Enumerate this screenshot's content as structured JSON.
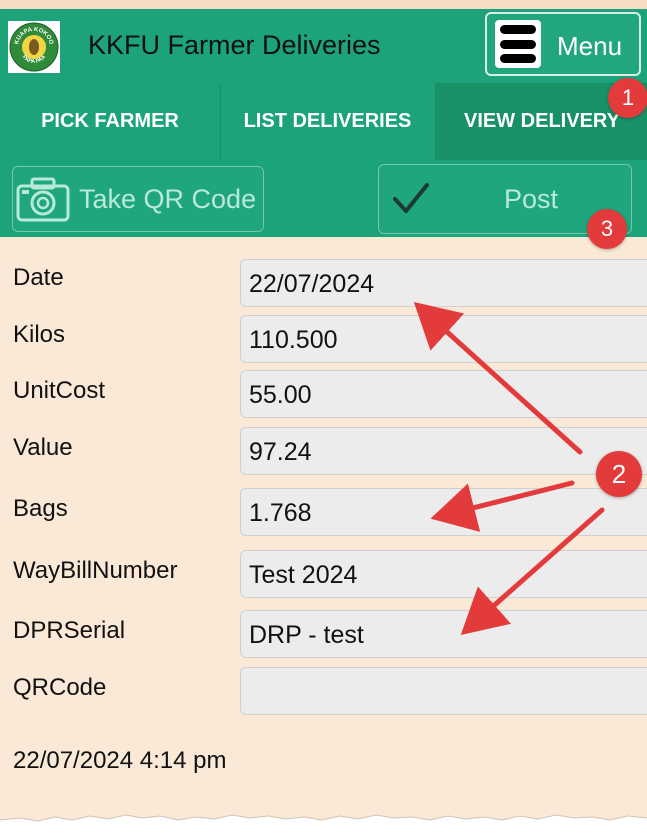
{
  "app": {
    "title": "KKFU Farmer Deliveries",
    "menu_label": "Menu",
    "logo_text_top": "KUAPA KOKOO",
    "logo_text_bottom": "PAPA PAA"
  },
  "tabs": [
    {
      "label": "PICK FARMER",
      "active": false
    },
    {
      "label": "LIST DELIVERIES",
      "active": false
    },
    {
      "label": "VIEW DELIVERY",
      "active": true
    }
  ],
  "actions": {
    "take_qr_label": "Take QR Code",
    "post_label": "Post",
    "camera_icon": "camera-icon",
    "check_icon": "checkmark-icon"
  },
  "form": {
    "fields": [
      {
        "label": "Date",
        "value": "22/07/2024"
      },
      {
        "label": "Kilos",
        "value": "110.500"
      },
      {
        "label": "UnitCost",
        "value": "55.00"
      },
      {
        "label": "Value",
        "value": "97.24"
      },
      {
        "label": "Bags",
        "value": "1.768"
      },
      {
        "label": "WayBillNumber",
        "value": "Test 2024"
      },
      {
        "label": "DPRSerial",
        "value": "DRP - test"
      },
      {
        "label": "QRCode",
        "value": ""
      }
    ],
    "timestamp": "22/07/2024 4:14 pm"
  },
  "annotations": {
    "badge_1": "1",
    "badge_2": "2",
    "badge_3": "3",
    "color": "#e33b3b"
  },
  "colors": {
    "header_green": "#1da37a",
    "active_tab_green": "#189167",
    "background": "#fbe9d7",
    "field_bg": "#ececec"
  }
}
